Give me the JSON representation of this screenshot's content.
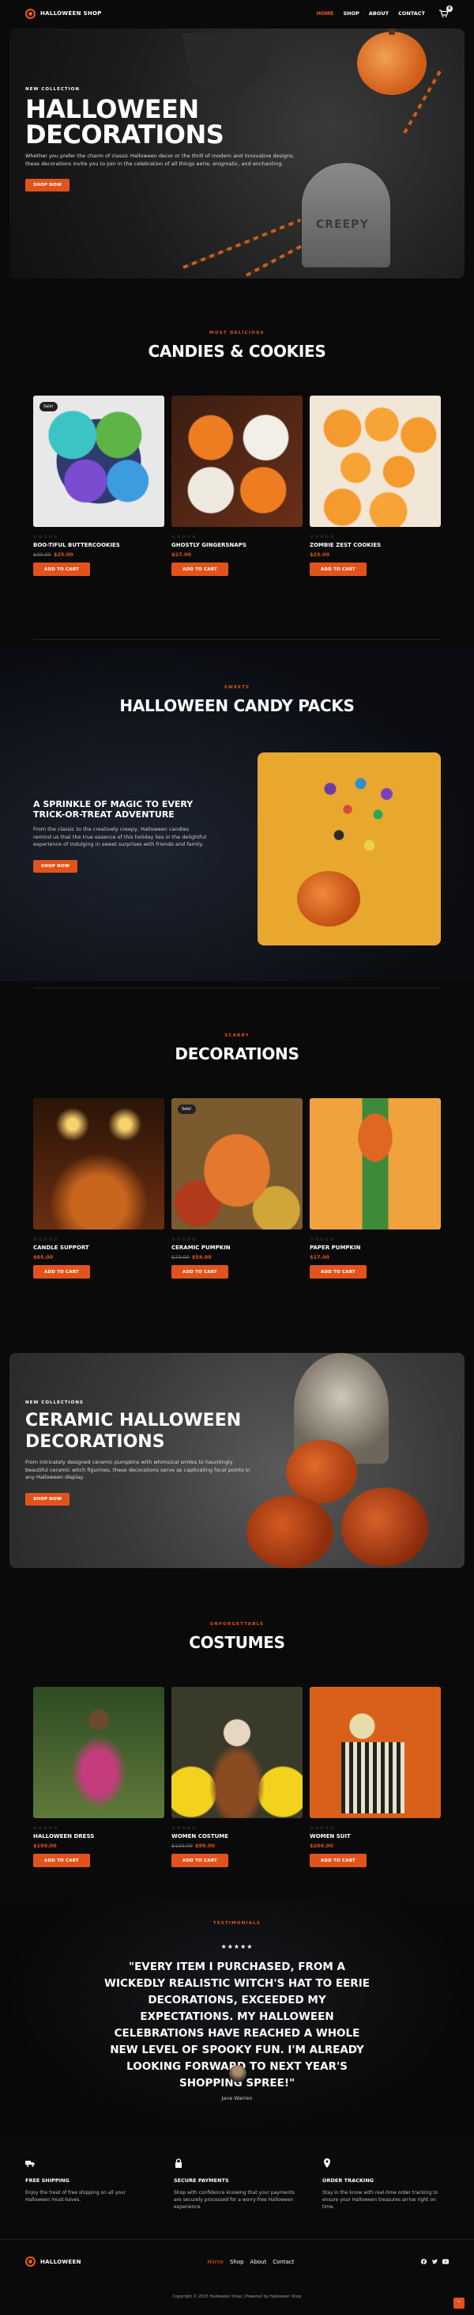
{
  "header": {
    "brand": "HALLOWEEN SHOP",
    "nav": [
      "HOME",
      "SHOP",
      "ABOUT",
      "CONTACT"
    ],
    "cart_count": "0",
    "accent": "#e2531c"
  },
  "hero": {
    "kicker": "NEW COLLECTION",
    "title": "HALLOWEEN DECORATIONS",
    "text": "Whether you prefer the charm of classic Halloween decor or the thrill of modern and innovative designs, these decorations invite you to join in the celebration of all things eerie, enigmatic, and enchanting.",
    "button": "SHOP NOW",
    "tombstone_text": "CREEPY"
  },
  "candies": {
    "kicker": "MOST DELICIOUS",
    "title": "CANDIES & COOKIES",
    "products": [
      {
        "name": "BOO-TIFUL BUTTERCOOKIES",
        "old_price": "$30.00",
        "price": "$25.00",
        "sale": "Sale!",
        "stars": "☆☆☆☆☆",
        "button": "ADD TO CART"
      },
      {
        "name": "GHOSTLY GINGERSNAPS",
        "old_price": "",
        "price": "$27.00",
        "sale": "",
        "stars": "☆☆☆☆☆",
        "button": "ADD TO CART"
      },
      {
        "name": "ZOMBIE ZEST COOKIES",
        "old_price": "",
        "price": "$25.00",
        "sale": "",
        "stars": "☆☆☆☆☆",
        "button": "ADD TO CART"
      }
    ]
  },
  "candy_packs": {
    "kicker": "SWEETS",
    "title": "HALLOWEEN CANDY PACKS",
    "subtitle": "A SPRINKLE OF MAGIC TO EVERY TRICK-OR-TREAT ADVENTURE",
    "text": "From the classic to the creatively creepy, Halloween candies remind us that the true essence of this holiday lies in the delightful experience of indulging in sweet surprises with friends and family.",
    "button": "SHOP NOW"
  },
  "decorations": {
    "kicker": "SCARRY",
    "title": "DECORATIONS",
    "products": [
      {
        "name": "CANDLE SUPPORT",
        "old_price": "",
        "price": "$65.00",
        "sale": "",
        "stars": "☆☆☆☆☆",
        "button": "ADD TO CART"
      },
      {
        "name": "CERAMIC PUMPKIN",
        "old_price": "$70.00",
        "price": "$59.00",
        "sale": "Sale!",
        "stars": "☆☆☆☆☆",
        "button": "ADD TO CART"
      },
      {
        "name": "PAPER PUMPKIN",
        "old_price": "",
        "price": "$17.00",
        "sale": "",
        "stars": "☆☆☆☆☆",
        "button": "ADD TO CART"
      }
    ]
  },
  "ceramic": {
    "kicker": "NEW COLLECTIONS",
    "title": "CERAMIC HALLOWEEN DECORATIONS",
    "text": "From intricately designed ceramic pumpkins with whimsical smiles to hauntingly beautiful ceramic witch figurines, these decorations serve as captivating focal points in any Halloween display.",
    "button": "SHOP NOW"
  },
  "costumes": {
    "kicker": "UNFORGETTABLE",
    "title": "COSTUMES",
    "products": [
      {
        "name": "HALLOWEEN DRESS",
        "old_price": "",
        "price": "$190.00",
        "sale": "",
        "stars": "☆☆☆☆☆",
        "button": "ADD TO CART"
      },
      {
        "name": "WOMEN COSTUME",
        "old_price": "$120.00",
        "price": "$99.00",
        "sale": "",
        "stars": "☆☆☆☆☆",
        "button": "ADD TO CART"
      },
      {
        "name": "WOMEN SUIT",
        "old_price": "",
        "price": "$200.00",
        "sale": "",
        "stars": "☆☆☆☆☆",
        "button": "ADD TO CART"
      }
    ]
  },
  "testimonial": {
    "kicker": "TESTIMONIALS",
    "stars": "★★★★★",
    "quote": "\"EVERY ITEM I PURCHASED, FROM A WICKEDLY REALISTIC WITCH'S HAT TO EERIE DECORATIONS, EXCEEDED MY EXPECTATIONS. MY HALLOWEEN CELEBRATIONS HAVE REACHED A WHOLE NEW LEVEL OF SPOOKY FUN. I'M ALREADY LOOKING FORWARD TO NEXT YEAR'S SHOPPING SPREE!\"",
    "author": "Jane Warren"
  },
  "features": [
    {
      "title": "FREE SHIPPING",
      "text": "Enjoy the treat of free shipping on all your Halloween must-haves."
    },
    {
      "title": "SECURE PAYMENTS",
      "text": "Shop with confidence knowing that your payments are securely processed for a worry-free Halloween experience."
    },
    {
      "title": "ORDER TRACKING",
      "text": "Stay in the know with real-time order tracking to ensure your Halloween treasures arrive right on time."
    }
  ],
  "footer": {
    "brand": "HALLOWEEN",
    "nav": [
      "Home",
      "Shop",
      "About",
      "Contact"
    ],
    "copyright": "Copyright © 2025 Halloween Shop | Powered by Halloween Shop"
  }
}
